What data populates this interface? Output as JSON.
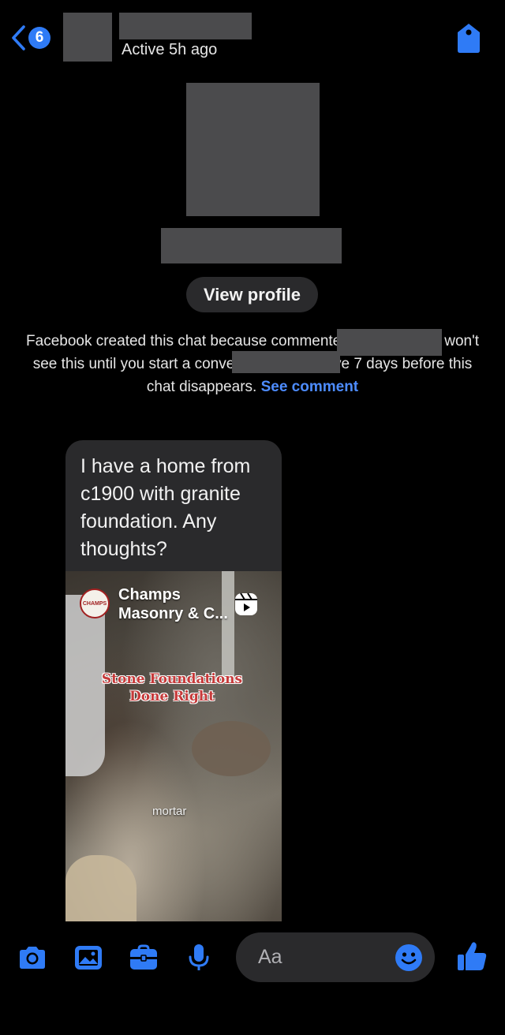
{
  "colors": {
    "accent": "#2f7bf6",
    "link": "#4d8cff",
    "bubble": "#2a2a2c",
    "redaction": "#4b4b4d",
    "background": "#000000"
  },
  "header": {
    "back_icon": "chevron-left-icon",
    "unread_count": "6",
    "status": "Active 5h ago",
    "right_icon": "tag-icon"
  },
  "profile": {
    "view_profile_label": "View profile"
  },
  "notice": {
    "part1": "Facebook created this chat because ",
    "part2": " commented on your post. ",
    "part3": " won't see this until you start a conversation. You have 7 days before this chat disappears. ",
    "see_comment": "See comment"
  },
  "message": {
    "text": "I have a home from c1900 with granite foundation. Any thoughts?",
    "shared_reel": {
      "account_name": "Champs Masonry & C...",
      "logo_text": "CHAMPS",
      "overlay_line1": "Stone Foundations",
      "overlay_line2": "Done Right",
      "caption": "mortar",
      "icon": "reels-icon"
    }
  },
  "composer": {
    "tools": [
      "camera-icon",
      "image-icon",
      "briefcase-icon",
      "microphone-icon"
    ],
    "placeholder": "Aa",
    "emoji_icon": "smiley-icon",
    "like_icon": "thumbs-up-icon"
  }
}
